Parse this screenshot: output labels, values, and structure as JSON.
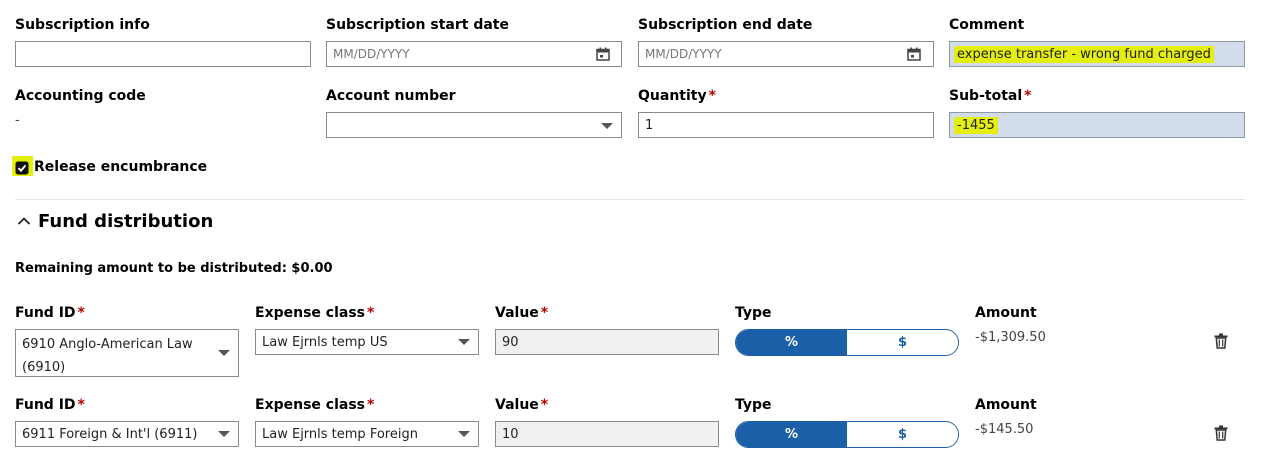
{
  "row1": {
    "subscription_info": {
      "label": "Subscription info",
      "value": ""
    },
    "start_date": {
      "label": "Subscription start date",
      "placeholder": "MM/DD/YYYY"
    },
    "end_date": {
      "label": "Subscription end date",
      "placeholder": "MM/DD/YYYY"
    },
    "comment": {
      "label": "Comment",
      "value": "expense transfer - wrong fund charged"
    }
  },
  "row2": {
    "accounting_code": {
      "label": "Accounting code",
      "value": "-"
    },
    "account_number": {
      "label": "Account number",
      "value": ""
    },
    "quantity": {
      "label": "Quantity",
      "value": "1"
    },
    "subtotal": {
      "label": "Sub-total",
      "value": "-1455"
    }
  },
  "required_mark": "*",
  "release_encumbrance": {
    "label": "Release encumbrance",
    "checked": true
  },
  "fund_distribution": {
    "title": "Fund distribution",
    "remaining": "Remaining amount to be distributed: $0.00",
    "rows": [
      {
        "fund_label": "Fund ID",
        "fund_value": "6910 Anglo-American Law (6910)",
        "expense_label": "Expense class",
        "expense_value": "Law Ejrnls temp US",
        "value_label": "Value",
        "value": "90",
        "type_label": "Type",
        "type_percent": "%",
        "type_dollar": "$",
        "amount_label": "Amount",
        "amount": "-$1,309.50"
      },
      {
        "fund_label": "Fund ID",
        "fund_value": "6911 Foreign & Int'l (6911)",
        "expense_label": "Expense class",
        "expense_value": "Law Ejrnls temp Foreign",
        "value_label": "Value",
        "value": "10",
        "type_label": "Type",
        "type_percent": "%",
        "type_dollar": "$",
        "amount_label": "Amount",
        "amount": "-$145.50"
      }
    ]
  },
  "icons": {
    "calendar": "calendar-icon",
    "trash": "trash-icon",
    "chevron": "chevron-up-icon",
    "caret": "caret-down-icon",
    "check": "checkbox-checked-icon"
  },
  "colors": {
    "accent": "#1a5fa8",
    "highlight": "#e4ee10",
    "highlight_field": "#d2dcea",
    "required": "#b00000"
  }
}
